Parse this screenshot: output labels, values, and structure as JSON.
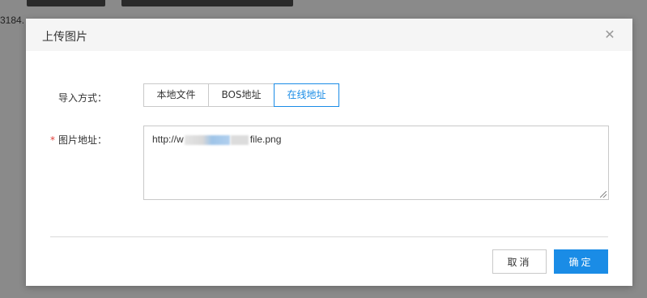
{
  "background": {
    "text_left": "3184.",
    "text_right": "1",
    "green_left": "© △ ⌂ ⊞",
    "green_right": "© △ ⌂ ⊞"
  },
  "dialog": {
    "title": "上传图片",
    "close_icon": "close-icon"
  },
  "form": {
    "import_label": "导入方式：",
    "import_options": [
      "本地文件",
      "BOS地址",
      "在线地址"
    ],
    "selected_option": "在线地址",
    "url_label": "图片地址：",
    "url_required_mark": "*",
    "url_value_prefix": "http://w",
    "url_value_suffix": "file.png"
  },
  "footer": {
    "cancel_label": "取消",
    "ok_label": "确定"
  },
  "colors": {
    "accent": "#1a8ce6",
    "required": "#e0403a"
  }
}
